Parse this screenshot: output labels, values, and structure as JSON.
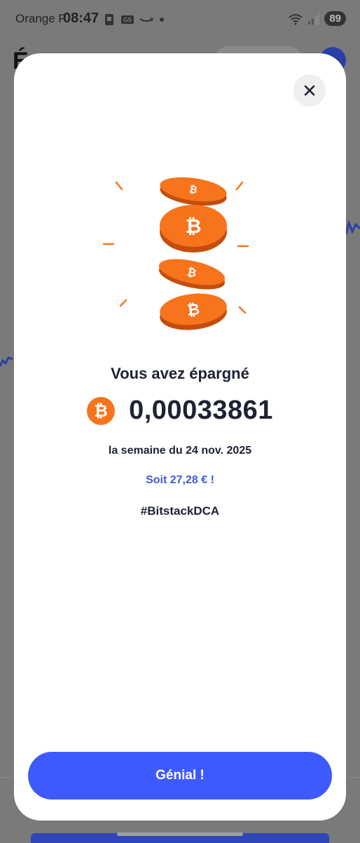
{
  "status_bar": {
    "carrier": "Orange F",
    "time": "08:47",
    "battery": "89",
    "icons": [
      "sim-card-icon",
      "gps-icon",
      "amazon-icon",
      "dot-icon",
      "wifi-icon",
      "signal-icon"
    ]
  },
  "background": {
    "title_letter": "É",
    "accent_color": "#2b3fa6"
  },
  "modal": {
    "close_icon": "close-icon",
    "illustration": "bitcoin-coins-illustration",
    "headline": "Vous avez épargné",
    "amount_icon": "bitcoin-icon",
    "amount": "0,00033861",
    "week": "la semaine du 24 nov. 2025",
    "fiat": "Soit 27,28 € !",
    "hashtag": "#BitstackDCA",
    "cta_label": "Génial !"
  },
  "colors": {
    "primary": "#3d5afe",
    "bitcoin_orange": "#f7731c",
    "text_dark": "#1d2233",
    "fiat_blue": "#3e5ad8"
  }
}
